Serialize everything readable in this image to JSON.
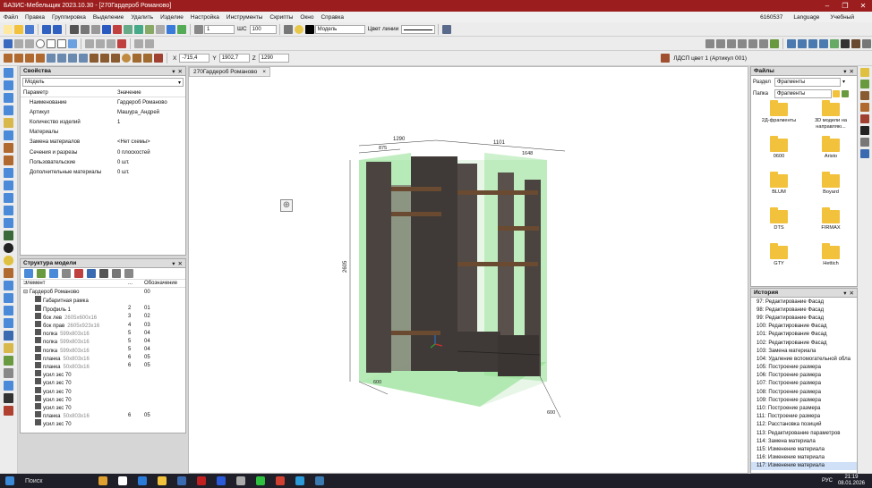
{
  "window": {
    "title": "БАЗИС-Мебельщик 2023.10.30 - [270Гардероб Романово]",
    "controls": [
      "–",
      "❐",
      "✕"
    ]
  },
  "menu": {
    "items": [
      "Файл",
      "Правка",
      "Группировка",
      "Выделение",
      "Удалить",
      "Изделие",
      "Настройка",
      "Инструменты",
      "Скрипты",
      "Окно",
      "Справка"
    ],
    "right_code": "6160537",
    "language": "Language",
    "mode": "Учебный"
  },
  "toolbar": {
    "layer_number": "1",
    "step_label": "ШС",
    "step_value": "100",
    "layer_name": "Модель",
    "line_color_label": "Цвет линии",
    "coord_x_label": "X",
    "coord_x": "-715,4",
    "coord_y_label": "Y",
    "coord_y": "1902,7",
    "coord_z_label": "Z",
    "coord_z": "1290",
    "material": "ЛДСП цвет 1 (Артикул 001)"
  },
  "tab": {
    "label": "270Гардероб Романово",
    "close": "×"
  },
  "properties": {
    "title": "Свойства",
    "selector": "Модель",
    "col_param": "Параметр",
    "col_value": "Значение",
    "rows": [
      [
        "Наименование",
        "Гардероб Романово"
      ],
      [
        "Артикул",
        "Машура_Андрей"
      ],
      [
        "Количество изделий",
        "1"
      ],
      [
        "Материалы",
        ""
      ],
      [
        "Замена материалов",
        "<Нет схемы>"
      ],
      [
        "Сечения и разрезы",
        "0 плоскостей"
      ],
      [
        "Пользовательские",
        "0 шт."
      ],
      [
        "Дополнительные материалы",
        "0 шт."
      ]
    ]
  },
  "structure": {
    "title": "Структура модели",
    "col_element": "Элемент",
    "col_dots": "...",
    "col_code": "Обозначение",
    "root": "Гардероб Романово",
    "root_code": "00",
    "rows": [
      [
        "Габаритная рамка",
        "",
        "",
        ""
      ],
      [
        "Профиль 1",
        "",
        "2",
        "01"
      ],
      [
        "бок лев",
        "2605x600x16",
        "3",
        "02"
      ],
      [
        "бок прав",
        "2605x923x16",
        "4",
        "03"
      ],
      [
        "полка",
        "599x803x16",
        "5",
        "04"
      ],
      [
        "полка",
        "599x803x16",
        "5",
        "04"
      ],
      [
        "полка",
        "599x803x16",
        "5",
        "04"
      ],
      [
        "планка",
        "50x803x16",
        "6",
        "05"
      ],
      [
        "планка",
        "50x803x16",
        "6",
        "05"
      ],
      [
        "усил экс 70",
        "",
        "",
        ""
      ],
      [
        "усил экс 70",
        "",
        "",
        ""
      ],
      [
        "усил экс 70",
        "",
        "",
        ""
      ],
      [
        "усил экс 70",
        "",
        "",
        ""
      ],
      [
        "усил экс 70",
        "",
        "",
        ""
      ],
      [
        "планка",
        "50x803x16",
        "6",
        "05"
      ],
      [
        "усил экс 70",
        "",
        "",
        ""
      ]
    ]
  },
  "files": {
    "title": "Файлы",
    "section_label": "Раздел",
    "section_value": "Фрагменты",
    "folder_label": "Папка",
    "folder_value": "Фрагменты",
    "folders": [
      "2Д-фрагменты",
      "3D модели на направляю...",
      "0600",
      "Aristo",
      "BLUM",
      "Boyard",
      "DTS",
      "FIRMAX",
      "GTY",
      "Hettich"
    ]
  },
  "history": {
    "title": "История",
    "items": [
      "97: Редактирование Фасад",
      "98: Редактирование Фасад",
      "99: Редактирование Фасад",
      "100: Редактирование Фасад",
      "101: Редактирование Фасад",
      "102: Редактирование Фасад",
      "103: Замена материала",
      "104: Удаление вспомогательной обла",
      "105: Построение размера",
      "106: Построение размера",
      "107: Построение размера",
      "108: Построение размера",
      "109: Построение размера",
      "110: Построение размера",
      "111: Построение размера",
      "112: Расстановка позиций",
      "113: Редактирование параметров",
      "114: Замена материала",
      "115: Изменение материала",
      "116: Изменение материала",
      "117: Изменение материала"
    ]
  },
  "dimensions": {
    "top_total": "1290",
    "top_left": "875",
    "top_right_total": "1101",
    "top_right": "1648",
    "height": "2605",
    "depth_left": "600",
    "depth_right": "600"
  },
  "taskbar": {
    "search": "Поиск",
    "time": "21:19",
    "date": "08.01.2026",
    "lang": "РУС"
  },
  "colors": {
    "title_bar": "#9c1d1d",
    "panel_fill": "#4a4340",
    "glass": "#8de08d",
    "accent": "#2a6fc9"
  }
}
